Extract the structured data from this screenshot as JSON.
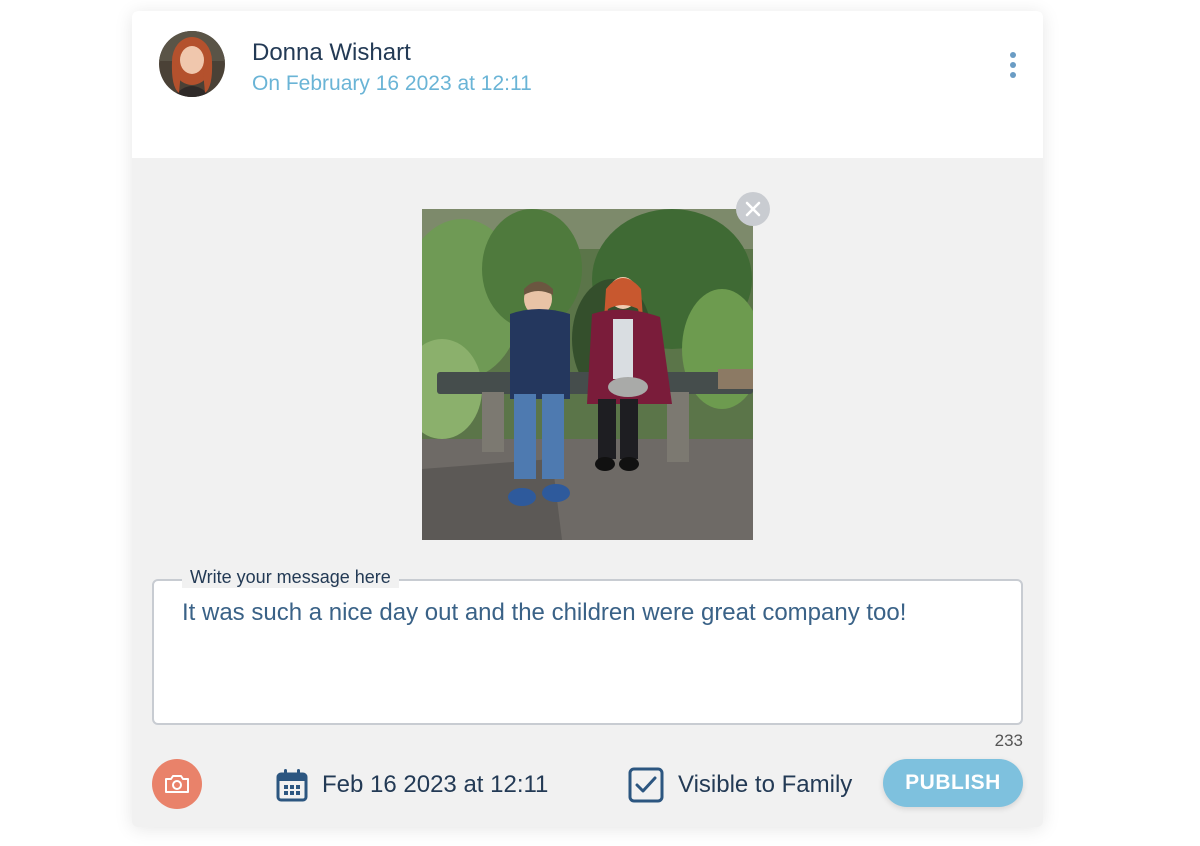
{
  "post": {
    "author_name": "Donna Wishart",
    "date": "On February 16 2023 at 12:11"
  },
  "composer": {
    "message_label": "Write your message here",
    "message_text": "It was such a nice day out and the children were great company too!",
    "char_count": "233",
    "date_value": "Feb 16 2023 at 12:11",
    "visibility_label": "Visible to Family",
    "visibility_checked": true,
    "publish_label": "PUBLISH"
  },
  "icons": {
    "more": "more-vertical-icon",
    "remove_photo": "close-icon",
    "camera": "camera-icon",
    "calendar": "calendar-icon",
    "checkbox": "checkbox-checked-icon"
  },
  "colors": {
    "name_text": "#233a55",
    "date_text": "#6ab4d6",
    "message_text": "#3a6287",
    "camera_button": "#e9826a",
    "publish_button": "#7ec1de",
    "card_background": "#f1f1f1"
  }
}
